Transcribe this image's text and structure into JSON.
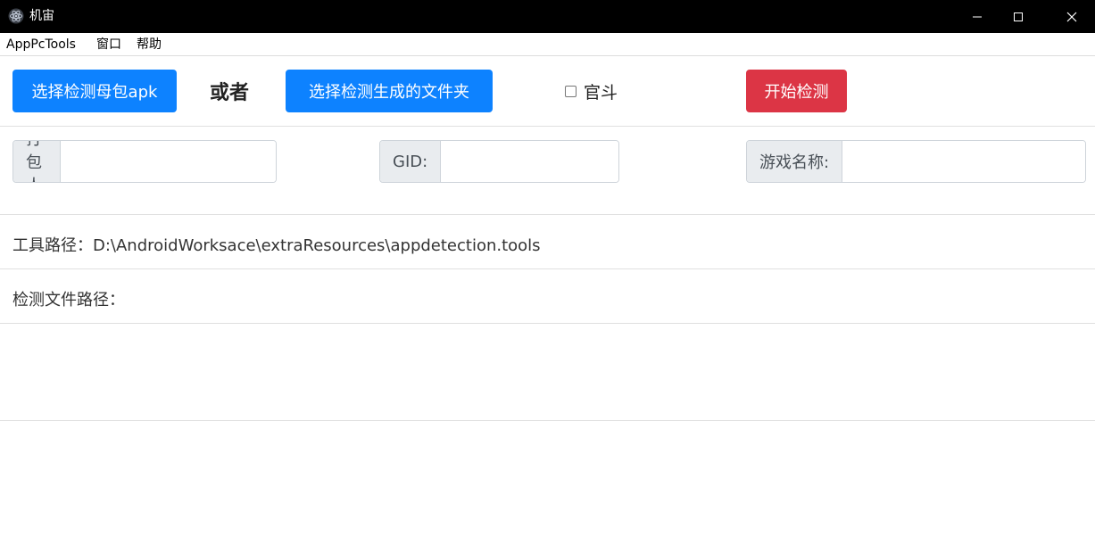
{
  "window": {
    "title": "机宙",
    "min_icon": "minimize-icon",
    "max_icon": "maximize-icon",
    "close_icon": "close-icon"
  },
  "menu": {
    "items": [
      "AppPcTools",
      "窗口",
      "帮助"
    ]
  },
  "toolbar": {
    "select_apk_label": "选择检测母包apk",
    "or_label": "或者",
    "select_folder_label": "选择检测生成的文件夹",
    "official_checkbox_label": "官斗",
    "official_checked": false,
    "start_label": "开始检测"
  },
  "form": {
    "packer_label": "打包人:",
    "packer_value": "",
    "gid_label": "GID:",
    "gid_value": "",
    "game_name_label": "游戏名称:",
    "game_name_value": ""
  },
  "info": {
    "tool_path": "工具路径：D:\\AndroidWorksace\\extraResources\\appdetection.tools",
    "detect_file_path": "检测文件路径："
  },
  "colors": {
    "primary": "#0d82ff",
    "danger": "#dc3545",
    "titlebar": "#000000"
  }
}
